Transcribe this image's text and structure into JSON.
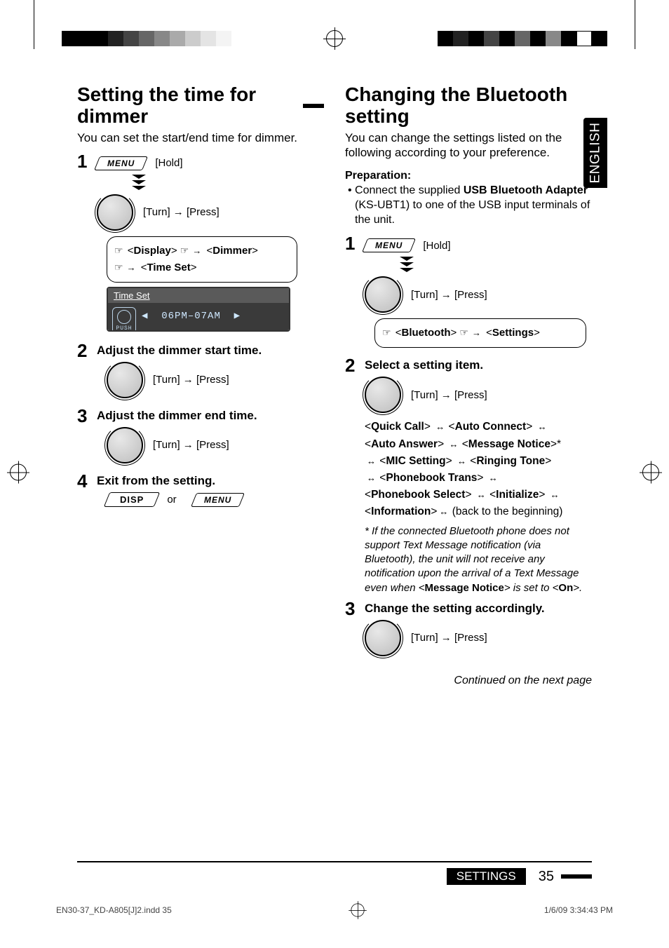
{
  "language_tab": "ENGLISH",
  "left": {
    "heading": "Setting the time for dimmer",
    "intro": "You can set the start/end time for dimmer.",
    "steps": {
      "s1": {
        "num": "1",
        "hold": "[Hold]",
        "turn_press": "[Turn] → [Press]",
        "menu_label": "MENU",
        "path": {
          "a": "Display",
          "b": "Dimmer",
          "c": "Time Set"
        },
        "screen_title": "Time Set",
        "screen_value": "06PM–07AM"
      },
      "s2": {
        "num": "2",
        "title": "Adjust the dimmer start time.",
        "turn_press": "[Turn] → [Press]"
      },
      "s3": {
        "num": "3",
        "title": "Adjust the dimmer end time.",
        "turn_press": "[Turn] → [Press]"
      },
      "s4": {
        "num": "4",
        "title": "Exit from the setting.",
        "disp": "DISP",
        "or": "or",
        "menu_label": "MENU"
      }
    }
  },
  "right": {
    "heading": "Changing the Bluetooth setting",
    "intro": "You can change the settings listed on the following according to your preference.",
    "prep_head": "Preparation:",
    "prep_body_prefix": "Connect the supplied ",
    "prep_body_bold": "USB Bluetooth Adapter",
    "prep_body_suffix": " (KS-UBT1) to one of the USB input terminals of the unit.",
    "steps": {
      "s1": {
        "num": "1",
        "hold": "[Hold]",
        "turn_press": "[Turn] → [Press]",
        "menu_label": "MENU",
        "path": {
          "a": "Bluetooth",
          "b": "Settings"
        }
      },
      "s2": {
        "num": "2",
        "title": "Select a setting item.",
        "turn_press": "[Turn] → [Press]",
        "options": {
          "quick_call": "Quick Call",
          "auto_connect": "Auto Connect",
          "auto_answer": "Auto Answer",
          "message_notice": "Message Notice",
          "mic_setting": "MIC Setting",
          "ringing_tone": "Ringing Tone",
          "phonebook_trans": "Phonebook Trans",
          "phonebook_select": "Phonebook Select",
          "initialize": "Initialize",
          "information": "Information",
          "back": "(back to the beginning)"
        },
        "note_prefix": "If the connected Bluetooth phone does not support Text Message notification (via Bluetooth), the unit will not receive any notification upon the arrival of a Text Message even when <",
        "note_bold1": "Message Notice",
        "note_mid": "> is set to <",
        "note_bold2": "On",
        "note_suffix": ">."
      },
      "s3": {
        "num": "3",
        "title": "Change the setting accordingly.",
        "turn_press": "[Turn] → [Press]"
      }
    },
    "continued": "Continued on the next page"
  },
  "footer": {
    "section": "SETTINGS",
    "page": "35",
    "file": "EN30-37_KD-A805[J]2.indd   35",
    "date": "1/6/09   3:34:43 PM"
  }
}
